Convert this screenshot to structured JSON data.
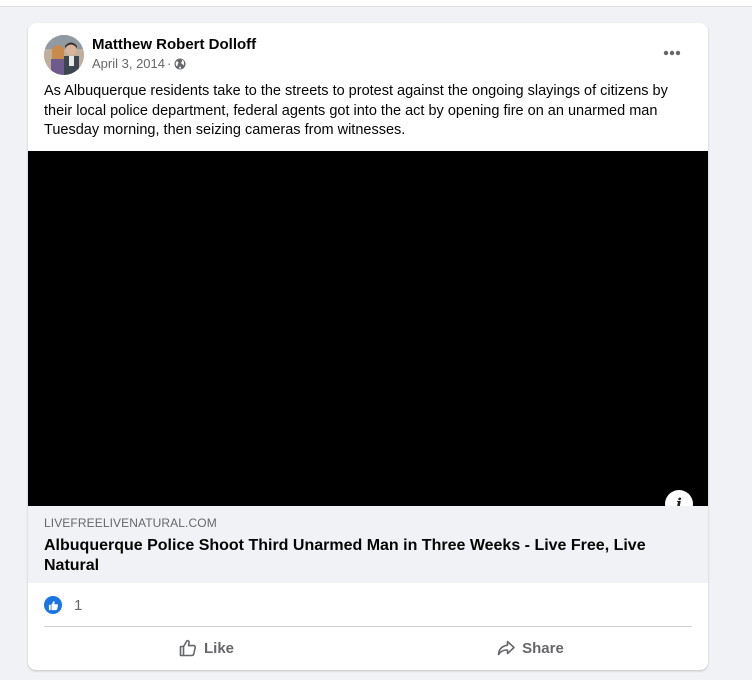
{
  "post": {
    "author": "Matthew Robert Dolloff",
    "date": "April 3, 2014",
    "separator": "·",
    "privacy_icon": "globe-icon",
    "more_icon": "more-options-icon",
    "text": "As Albuquerque residents take to the streets to protest against the ongoing slayings of citizens by their local police department, federal agents got into the act by opening fire on an unarmed man Tuesday morning, then seizing cameras from witnesses."
  },
  "video": {
    "background": "#000000",
    "info_glyph": "i"
  },
  "link": {
    "domain": "LIVEFREELIVENATURAL.COM",
    "title": "Albuquerque Police Shoot Third Unarmed Man in Three Weeks - Live Free, Live Natural"
  },
  "reactions": {
    "icon": "like-reaction-icon",
    "count": "1"
  },
  "actions": {
    "like_label": "Like",
    "share_label": "Share"
  },
  "colors": {
    "accent": "#1b74e4",
    "page_bg": "#f0f2f5",
    "secondary_text": "#65676b"
  }
}
